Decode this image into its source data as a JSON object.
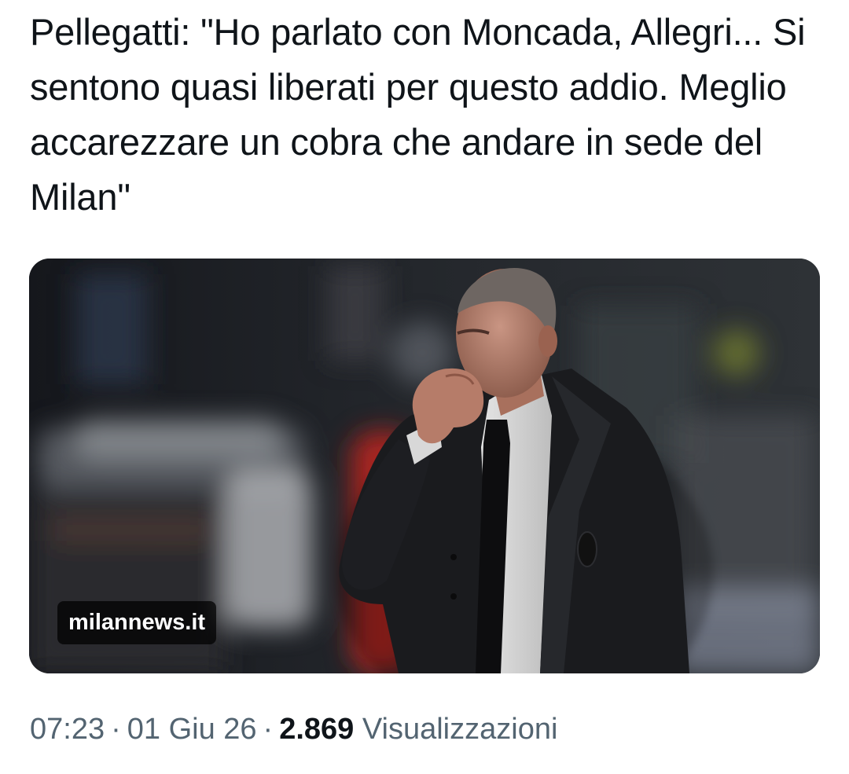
{
  "tweet": {
    "text": "Pellegatti: \"Ho parlato con Moncada, Allegri... Si sentono quasi liberati per questo addio. Meglio accarezzare un cobra che andare in sede del Milan\""
  },
  "media": {
    "source_label": "milannews.it"
  },
  "meta": {
    "time": "07:23",
    "separator": "·",
    "date": "01 Giu 26",
    "views_count": "2.869",
    "views_label": "Visualizzazioni"
  },
  "colors": {
    "text_primary": "#0f1419",
    "text_secondary": "#536471",
    "badge_bg": "#000000"
  }
}
